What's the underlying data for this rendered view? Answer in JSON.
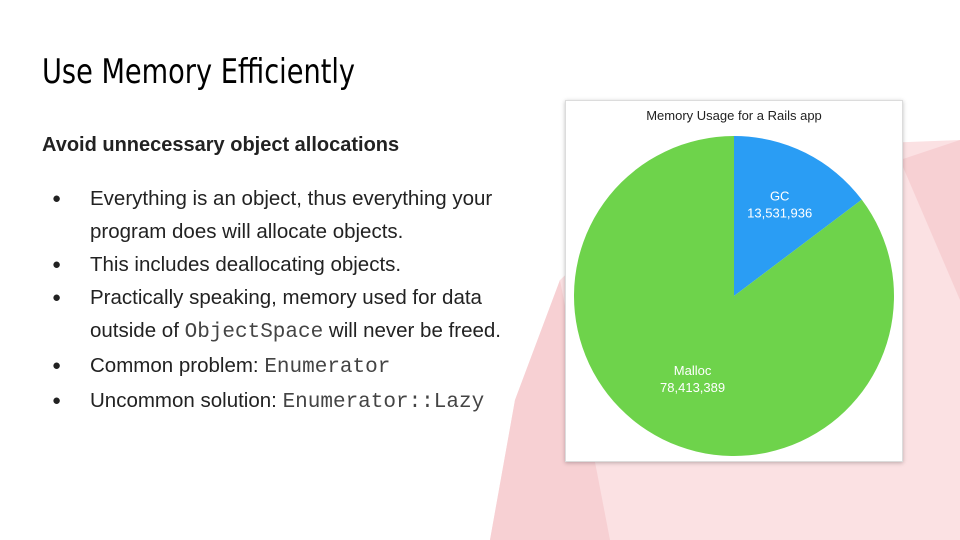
{
  "slide": {
    "title": "Use Memory Efficiently",
    "subtitle": "Avoid unnecessary object allocations",
    "bullets": [
      {
        "text_1": "Everything is an object, thus everything your program does will allocate objects."
      },
      {
        "text_1": "This includes deallocating objects."
      },
      {
        "text_1": "Practically speaking, memory used for data outside of ",
        "code": "ObjectSpace",
        "text_2": " will never be freed."
      },
      {
        "text_1": "Common problem: ",
        "code": "Enumerator"
      },
      {
        "text_1": "Uncommon solution: ",
        "code": "Enumerator::Lazy"
      }
    ]
  },
  "colors": {
    "gc": "#2a9df4",
    "malloc": "#6ed34b",
    "decoration": "#fbe1e3"
  },
  "chart_data": {
    "type": "pie",
    "title": "Memory Usage for a Rails app",
    "slices": [
      {
        "label": "GC",
        "value": 13531936,
        "value_label": "13,531,936"
      },
      {
        "label": "Malloc",
        "value": 78413389,
        "value_label": "78,413,389"
      }
    ]
  }
}
